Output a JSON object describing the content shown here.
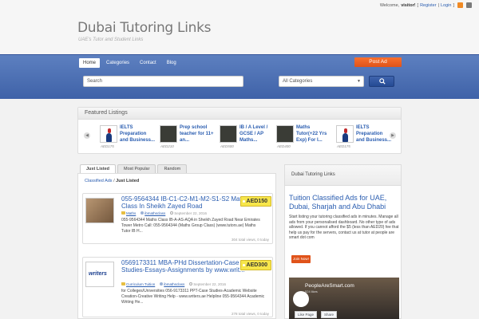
{
  "header": {
    "welcome_prefix": "Welcome,",
    "username": "visitor!",
    "register": "Register",
    "login": "Login",
    "site_title": "Dubai Tutoring Links",
    "tagline": "UAE's Tutor and Student Links"
  },
  "nav": {
    "items": [
      "Home",
      "Categories",
      "Contact",
      "Blog"
    ],
    "post_ad": "Post Ad"
  },
  "search": {
    "placeholder": "Search",
    "category_selected": "All Categories"
  },
  "featured": {
    "heading": "Featured Listings",
    "items": [
      {
        "title": "IELTS Preparation and Business...",
        "price": "AED175"
      },
      {
        "title": "Prep school teacher for 11+ an...",
        "price": "AED210"
      },
      {
        "title": "IB / A Level / GCSE / AP Maths...",
        "price": "AED500"
      },
      {
        "title": "Maths Tutor(+22 Yrs Exp) For I...",
        "price": "AED400"
      },
      {
        "title": "IELTS Preparation and Business...",
        "price": "AED175"
      }
    ]
  },
  "tabs": [
    "Just Listed",
    "Most Popular",
    "Random"
  ],
  "breadcrumb": {
    "root": "Classified Ads",
    "separator": "/",
    "current": "Just Listed"
  },
  "listings": [
    {
      "title": "055-9564344 IB-C1-C2-M1-M2-S1-S2 Maths Class In Sheikh Zayed Road",
      "price": "AED150",
      "category": "Maths",
      "author": "ibmathsclass",
      "date": "September 22, 2016",
      "description": "055-9564344 Maths Class IB-A-AS-AQA in Sheikh Zayed Road Near Emirates Tower Metro Call: 055-9564344 (Maths Group Class) (www.tutors.ae) Maths Tutor IB H...",
      "stats": "304 total views, 0 today"
    },
    {
      "title": "0569173311 MBA-PHd Dissertation-Case Studies-Essays-Assignments by www.writ...",
      "price": "AED300",
      "category": "Curriculum Tuition",
      "author": "ibmathsclass",
      "date": "September 22, 2016",
      "description": "for Colleges/Universities 056-9173311 PPT-Case Studies-Academic Website Creation-Creative Writing Help - www.writers.ae Helpline 055-9564344 Academic Writing He...",
      "stats": "278 total views, 0 today",
      "thumb_text": "writers"
    }
  ],
  "sidebar": {
    "heading": "Dubai Tutoring Links",
    "promo_title": "Tuition Classified Ads for UAE, Dubai, Sharjah and Abu Dhabi",
    "promo_text": "Start listing your tutoring classified ads in minutes. Manage all ads from your personalised dashboard. No other type of ads allowed. If you cannot afford the $5 (less than AED20) fee that help us pay for the servers, contact us at tutor at people are smart dot com",
    "join_label": "Join Now!",
    "fb_page_name": "PeopleAreSmart.com",
    "fb_likes": "524 likes",
    "fb_like_label": "Like Page",
    "fb_share_label": "Share"
  },
  "colors": {
    "nav_blue": "#4a6db0",
    "accent_orange": "#e0531a",
    "link_blue": "#2a5db0",
    "price_yellow": "#f7e64a"
  }
}
